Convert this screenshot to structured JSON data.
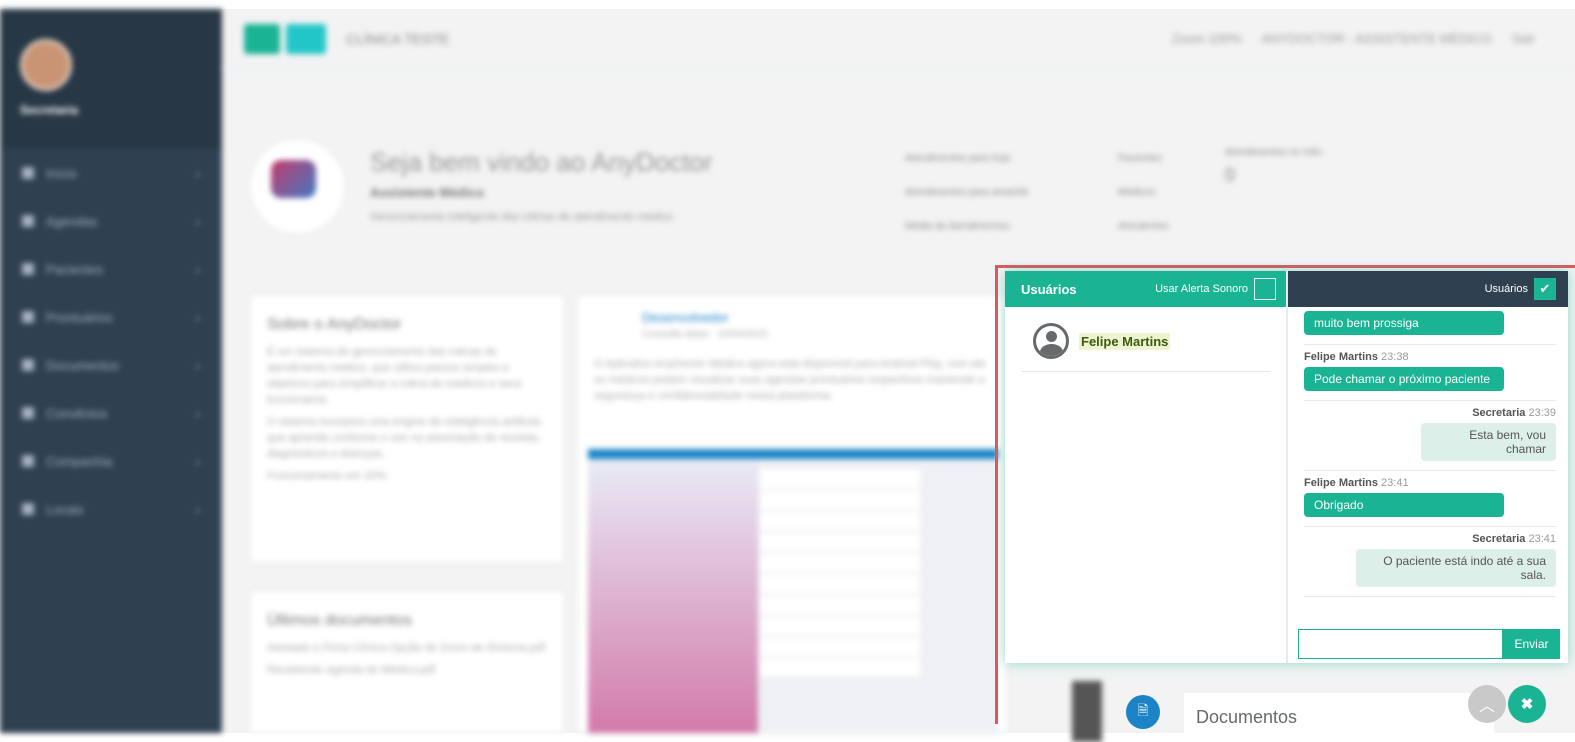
{
  "sidebar": {
    "username": "Secretaria",
    "items": [
      {
        "label": "Início"
      },
      {
        "label": "Agendas"
      },
      {
        "label": "Pacientes"
      },
      {
        "label": "Prontuários"
      },
      {
        "label": "Documentos"
      },
      {
        "label": "Convênios"
      },
      {
        "label": "Companhia"
      },
      {
        "label": "Locais"
      }
    ]
  },
  "topbar": {
    "clinic": "CLÍNICA TESTE",
    "zoom": "Zoom 100%",
    "role": "ANYDOCTOR - ASSISTENTE MÉDICO",
    "exit": "Sair"
  },
  "welcome": {
    "title": "Seja bem vindo ao AnyDoctor",
    "subtitle": "Assistente Médico",
    "description": "Gerenciamento inteligente das rotinas de atendimento médico",
    "stats": [
      "Atendimentos para hoje",
      "Atendimentos para amanhã",
      "Média de Atendimentos",
      "Pacientes",
      "Médicos",
      "Atendentes",
      "Atendimentos no mês",
      "0"
    ]
  },
  "about": {
    "title": "Sobre o AnyDoctor",
    "p1": "É um sistema de gerenciamento das rotinas de atendimento médico, que utiliza passos simples e objetivos para simplificar a rotina de médicos e seus funcionários.",
    "p2": "O sistema incorpora uma engine de inteligência artificial, que aprende conforme o uso na associação de receitas, diagnósticos e doenças.",
    "status": "Funcionamento em 20%"
  },
  "docs_card": {
    "title": "Últimos documentos",
    "items": [
      "Atestado e Ficha Clínica Opção de Zoom de Sintoma.pdf",
      "Recebendo agenda do Médico.pdf"
    ]
  },
  "post": {
    "author": "Desenvolvedor",
    "meta": "Consulta datas - 10/04/2015",
    "text": "O Aplicativo AnyDoctor Médico agora está disponível para Android Play, com ele os médicos podem visualizar suas agendas prontuários respectivos mantendo a segurança e confidencialidade nossa plataforma."
  },
  "chat": {
    "users_title": "Usuários",
    "sound_alert": "Usar Alerta Sonoro",
    "users_tab": "Usuários",
    "users": [
      {
        "name": "Felipe Martins"
      }
    ],
    "messages": [
      {
        "sender": "",
        "time": "",
        "text": "muito bem prossiga",
        "side": "left"
      },
      {
        "sender": "Felipe Martins",
        "time": "23:38",
        "text": "Pode chamar o próximo paciente",
        "side": "left"
      },
      {
        "sender": "Secretaria",
        "time": "23:39",
        "text": "Esta bem, vou chamar",
        "side": "right"
      },
      {
        "sender": "Felipe Martins",
        "time": "23:41",
        "text": "Obrigado",
        "side": "left"
      },
      {
        "sender": "Secretaria",
        "time": "23:41",
        "text": "O paciente está indo até a sua sala.",
        "side": "right"
      }
    ],
    "input_value": "",
    "send_label": "Enviar"
  },
  "bottom": {
    "documents_label": "Documentos"
  },
  "colors": {
    "primary": "#1ab394",
    "sidebar": "#2f4050",
    "highlight_frame": "#e0575b"
  }
}
